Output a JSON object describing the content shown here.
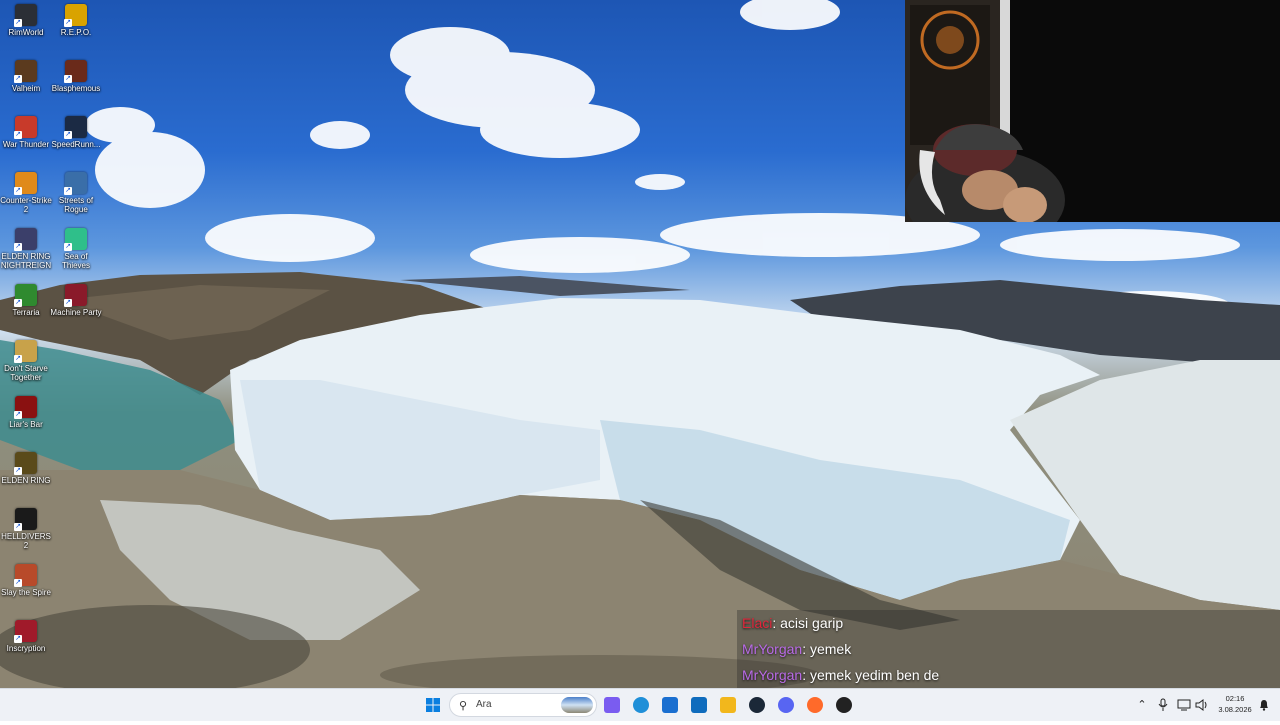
{
  "desktop": {
    "icons": [
      {
        "label": "RimWorld",
        "color": "#2b2f36"
      },
      {
        "label": "R.E.P.O.",
        "color": "#d9a300"
      },
      {
        "label": "Valheim",
        "color": "#5b3a1e"
      },
      {
        "label": "Blasphemous",
        "color": "#6a2a1a"
      },
      {
        "label": "War Thunder",
        "color": "#c83a2a"
      },
      {
        "label": "SpeedRunn...",
        "color": "#1b2a44"
      },
      {
        "label": "Counter-Strike 2",
        "color": "#e08a1a"
      },
      {
        "label": "Streets of Rogue",
        "color": "#3a6ea8"
      },
      {
        "label": "ELDEN RING NIGHTREIGN",
        "color": "#3b3f6a"
      },
      {
        "label": "Sea of Thieves",
        "color": "#2fbf8a"
      },
      {
        "label": "Terraria",
        "color": "#2f8a2f"
      },
      {
        "label": "Machine Party",
        "color": "#8a1a2a"
      },
      {
        "label": "Don't Starve Together",
        "color": "#c8a24a"
      },
      {
        "label": "Liar's Bar",
        "color": "#8a1111"
      },
      {
        "label": "ELDEN RING",
        "color": "#5a4a1a"
      },
      {
        "label": "HELLDIVERS 2",
        "color": "#1a1a1a"
      },
      {
        "label": "Slay the Spire",
        "color": "#b84a2a"
      },
      {
        "label": "Inscryption",
        "color": "#a01a2a"
      }
    ]
  },
  "chat": {
    "messages": [
      {
        "user": "Elaci",
        "user_color": "#e0263b",
        "text": ": acisi garip"
      },
      {
        "user": "MrYorgan",
        "user_color": "#b86ae6",
        "text": ": yemek"
      },
      {
        "user": "MrYorgan",
        "user_color": "#b86ae6",
        "text": ": yemek yedim ben de"
      }
    ]
  },
  "taskbar": {
    "search_placeholder": "Ara",
    "apps": [
      {
        "name": "copilot-icon",
        "color": "#7a5cf0"
      },
      {
        "name": "edge-icon",
        "color": "#1f8fd8"
      },
      {
        "name": "store-icon",
        "color": "#1a6fd0"
      },
      {
        "name": "outlook-icon",
        "color": "#0f6cbd"
      },
      {
        "name": "file-explorer-icon",
        "color": "#f2b71c"
      },
      {
        "name": "steam-icon",
        "color": "#1b2838"
      },
      {
        "name": "discord-icon",
        "color": "#5865f2"
      },
      {
        "name": "firefox-icon",
        "color": "#ff6a2a"
      },
      {
        "name": "obs-icon",
        "color": "#222222"
      }
    ],
    "time": "02:16",
    "date": "3.08.2026"
  }
}
